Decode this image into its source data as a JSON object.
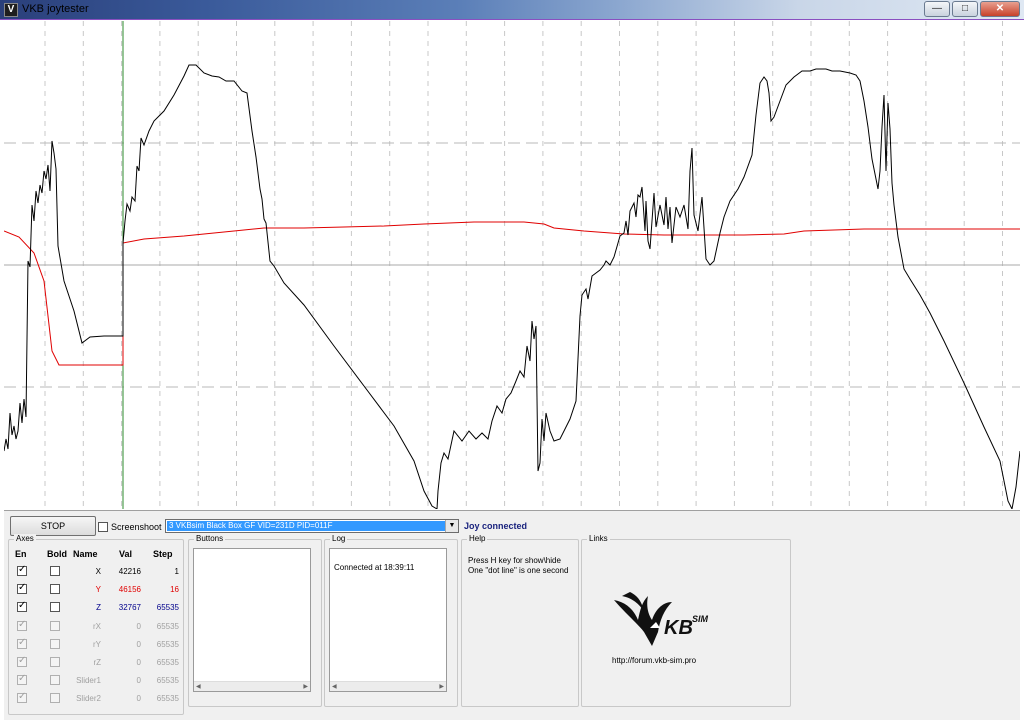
{
  "window": {
    "title": "VKB joytester",
    "icon": "V"
  },
  "controls": {
    "stop_label": "STOP",
    "screenshot_label": "Screenshoot",
    "device_selected": "3 VKBsim Black Box GF  VID=231D PID=011F",
    "status": "Joy connected"
  },
  "axes": {
    "title": "Axes",
    "headers": {
      "en": "En",
      "bold": "Bold",
      "name": "Name",
      "val": "Val",
      "step": "Step"
    },
    "rows": [
      {
        "name": "X",
        "val": "42216",
        "step": "1",
        "enabled": true,
        "color": "#000000"
      },
      {
        "name": "Y",
        "val": "46156",
        "step": "16",
        "enabled": true,
        "color": "#e00000"
      },
      {
        "name": "Z",
        "val": "32767",
        "step": "65535",
        "enabled": true,
        "color": "#00008b"
      },
      {
        "name": "rX",
        "val": "0",
        "step": "65535",
        "enabled": false,
        "color": "#a0a0a0"
      },
      {
        "name": "rY",
        "val": "0",
        "step": "65535",
        "enabled": false,
        "color": "#a0a0a0"
      },
      {
        "name": "rZ",
        "val": "0",
        "step": "65535",
        "enabled": false,
        "color": "#a0a0a0"
      },
      {
        "name": "Slider1",
        "val": "0",
        "step": "65535",
        "enabled": false,
        "color": "#a0a0a0"
      },
      {
        "name": "Slider2",
        "val": "0",
        "step": "65535",
        "enabled": false,
        "color": "#a0a0a0"
      }
    ]
  },
  "buttons_group": {
    "title": "Buttons"
  },
  "log_group": {
    "title": "Log",
    "entries": [
      "Connected at 18:39:11"
    ]
  },
  "help_group": {
    "title": "Help",
    "lines": [
      "Press H key for show\\hide",
      "One \"dot line\" is one second"
    ]
  },
  "links_group": {
    "title": "Links",
    "logo_text": "KB",
    "logo_sub": "SIM",
    "url": "http://forum.vkb-sim.pro"
  },
  "colors": {
    "x_trace": "#000000",
    "y_trace": "#e00000",
    "cursor": "#2e8b2e",
    "grid": "#c0c0c0"
  }
}
